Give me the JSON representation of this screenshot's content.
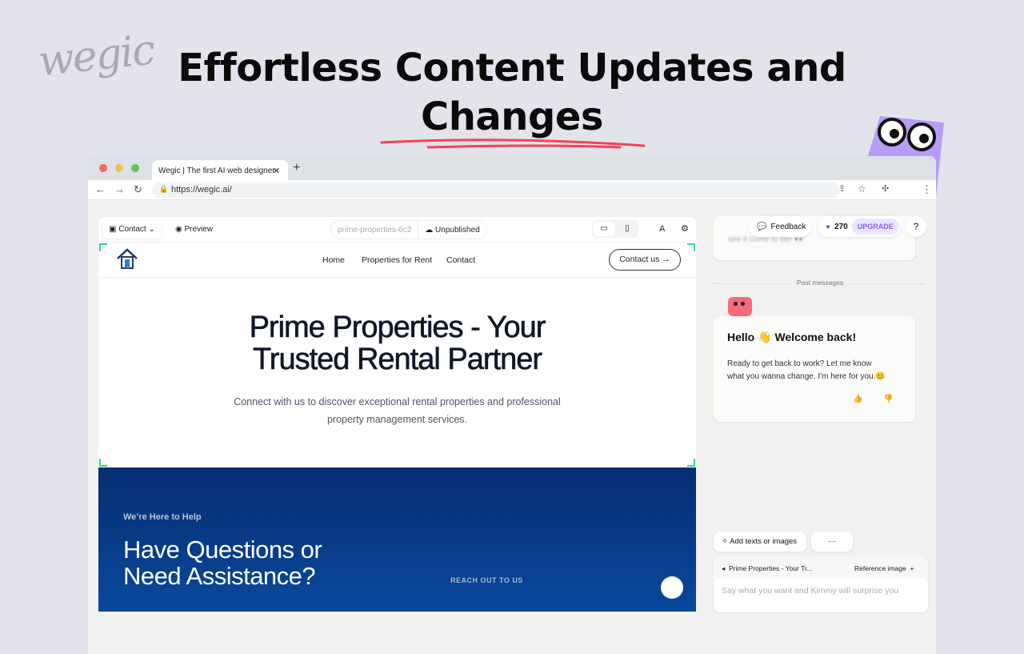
{
  "brand": {
    "logo_text": "wegic"
  },
  "headline": {
    "line1": "Effortless Content Updates and",
    "line2": "Changes"
  },
  "colors": {
    "accent_red": "#f0435a",
    "accent_purple": "#8b5cf6",
    "hero_blue": "#062d72",
    "selection_green": "#38d39f"
  },
  "browser": {
    "tab_title": "Wegic | The first AI web designer",
    "url": "https://wegic.ai/"
  },
  "editor": {
    "page_select": "Contact",
    "preview": "Preview",
    "site_slug": "prime-properties-6c2",
    "publish_status": "Unpublished"
  },
  "site": {
    "nav": [
      "Home",
      "Properties for Rent",
      "Contact"
    ],
    "cta": "Contact us",
    "hero_title_1": "Prime Properties - Your",
    "hero_title_2": "Trusted Rental Partner",
    "hero_sub_1": "Connect with us to discover exceptional rental properties and professional",
    "hero_sub_2": "property management services.",
    "eyebrow": "We’re Here to Help",
    "section_title_1": "Have Questions or",
    "section_title_2": "Need Assistance?",
    "reach_out": "REACH OUT TO US"
  },
  "panel": {
    "feedback": "Feedback",
    "credits": "270",
    "upgrade": "UPGRADE",
    "help": "?",
    "prev_msg": "see it come to life! 👀",
    "past_messages": "Past messages",
    "greeting": "Hello 👋 Welcome back!",
    "message_1": "Ready to get back to work? Let me know",
    "message_2": "what you wanna change. I'm here for you.😊",
    "add_texts": "Add texts or images",
    "more": "···",
    "context": "Prime Properties - Your Tr...",
    "reference": "Reference image",
    "input_placeholder": "Say what you want and Kimmy will surprise you"
  }
}
